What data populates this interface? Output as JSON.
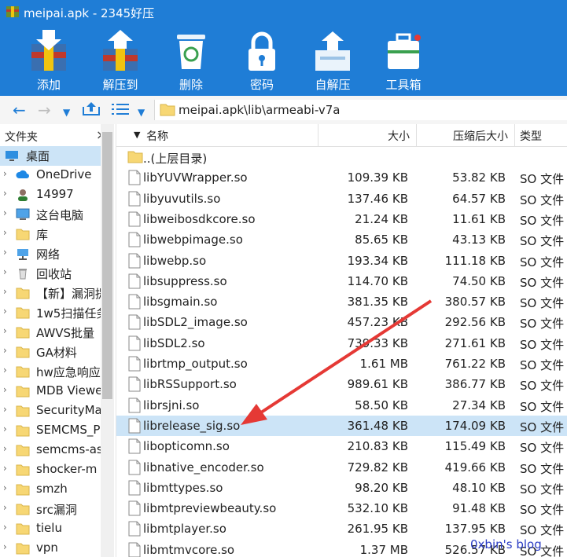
{
  "window": {
    "title": "meipai.apk - 2345好压"
  },
  "toolbar": [
    {
      "label": "添加",
      "icon": "add-icon"
    },
    {
      "label": "解压到",
      "icon": "extract-icon"
    },
    {
      "label": "删除",
      "icon": "delete-icon"
    },
    {
      "label": "密码",
      "icon": "password-icon"
    },
    {
      "label": "自解压",
      "icon": "sfx-icon"
    },
    {
      "label": "工具箱",
      "icon": "toolbox-icon"
    }
  ],
  "address": {
    "path": "meipai.apk\\lib\\armeabi-v7a"
  },
  "sidebar": {
    "header": "文件夹",
    "close": "×",
    "items": [
      {
        "label": "桌面",
        "icon": "desktop-icon",
        "selected": true
      },
      {
        "label": "OneDrive",
        "icon": "cloud-icon"
      },
      {
        "label": "14997",
        "icon": "user-icon"
      },
      {
        "label": "这台电脑",
        "icon": "computer-icon"
      },
      {
        "label": "库",
        "icon": "folder-icon"
      },
      {
        "label": "网络",
        "icon": "network-icon"
      },
      {
        "label": "回收站",
        "icon": "recycle-bin-icon"
      },
      {
        "label": "【新】漏洞提",
        "icon": "folder-icon"
      },
      {
        "label": "1w5扫描任务",
        "icon": "folder-icon"
      },
      {
        "label": "AWVS批量",
        "icon": "folder-icon"
      },
      {
        "label": "GA材料",
        "icon": "folder-icon"
      },
      {
        "label": "hw应急响应",
        "icon": "folder-icon"
      },
      {
        "label": "MDB Viewer",
        "icon": "folder-icon"
      },
      {
        "label": "SecurityMa",
        "icon": "folder-icon"
      },
      {
        "label": "SEMCMS_P",
        "icon": "folder-icon"
      },
      {
        "label": "semcms-as",
        "icon": "folder-icon"
      },
      {
        "label": "shocker-m",
        "icon": "folder-icon"
      },
      {
        "label": "smzh",
        "icon": "folder-icon"
      },
      {
        "label": "src漏洞",
        "icon": "folder-icon"
      },
      {
        "label": "tielu",
        "icon": "folder-icon"
      },
      {
        "label": "vpn",
        "icon": "folder-icon"
      }
    ]
  },
  "columns": {
    "name": "名称",
    "size": "大小",
    "packed": "压缩后大小",
    "type": "类型"
  },
  "parent_row": "..(上层目录)",
  "files": [
    {
      "name": "libYUVWrapper.so",
      "size": "109.39 KB",
      "packed": "53.82 KB",
      "type": "SO 文件"
    },
    {
      "name": "libyuvutils.so",
      "size": "137.46 KB",
      "packed": "64.57 KB",
      "type": "SO 文件"
    },
    {
      "name": "libweibosdkcore.so",
      "size": "21.24 KB",
      "packed": "11.61 KB",
      "type": "SO 文件"
    },
    {
      "name": "libwebpimage.so",
      "size": "85.65 KB",
      "packed": "43.13 KB",
      "type": "SO 文件"
    },
    {
      "name": "libwebp.so",
      "size": "193.34 KB",
      "packed": "111.18 KB",
      "type": "SO 文件"
    },
    {
      "name": "libsuppress.so",
      "size": "114.70 KB",
      "packed": "74.50 KB",
      "type": "SO 文件"
    },
    {
      "name": "libsgmain.so",
      "size": "381.35 KB",
      "packed": "380.57 KB",
      "type": "SO 文件"
    },
    {
      "name": "libSDL2_image.so",
      "size": "457.23 KB",
      "packed": "292.56 KB",
      "type": "SO 文件"
    },
    {
      "name": "libSDL2.so",
      "size": "739.33 KB",
      "packed": "271.61 KB",
      "type": "SO 文件"
    },
    {
      "name": "librtmp_output.so",
      "size": "1.61 MB",
      "packed": "761.22 KB",
      "type": "SO 文件"
    },
    {
      "name": "libRSSupport.so",
      "size": "989.61 KB",
      "packed": "386.77 KB",
      "type": "SO 文件"
    },
    {
      "name": "librsjni.so",
      "size": "58.50 KB",
      "packed": "27.34 KB",
      "type": "SO 文件"
    },
    {
      "name": "librelease_sig.so",
      "size": "361.48 KB",
      "packed": "174.09 KB",
      "type": "SO 文件",
      "selected": true
    },
    {
      "name": "libopticomn.so",
      "size": "210.83 KB",
      "packed": "115.49 KB",
      "type": "SO 文件"
    },
    {
      "name": "libnative_encoder.so",
      "size": "729.82 KB",
      "packed": "419.66 KB",
      "type": "SO 文件"
    },
    {
      "name": "libmttypes.so",
      "size": "98.20 KB",
      "packed": "48.10 KB",
      "type": "SO 文件"
    },
    {
      "name": "libmtpreviewbeauty.so",
      "size": "532.10 KB",
      "packed": "91.48 KB",
      "type": "SO 文件"
    },
    {
      "name": "libmtplayer.so",
      "size": "261.95 KB",
      "packed": "137.95 KB",
      "type": "SO 文件"
    },
    {
      "name": "libmtmvcore.so",
      "size": "1.37 MB",
      "packed": "526.57 KB",
      "type": "SO 文件"
    }
  ],
  "watermark": "0xbin's blog",
  "colors": {
    "title_bar": "#1f7dd6",
    "selection": "#cce4f7",
    "annotation_arrow": "#e53935",
    "watermark": "#2a3cc4"
  }
}
